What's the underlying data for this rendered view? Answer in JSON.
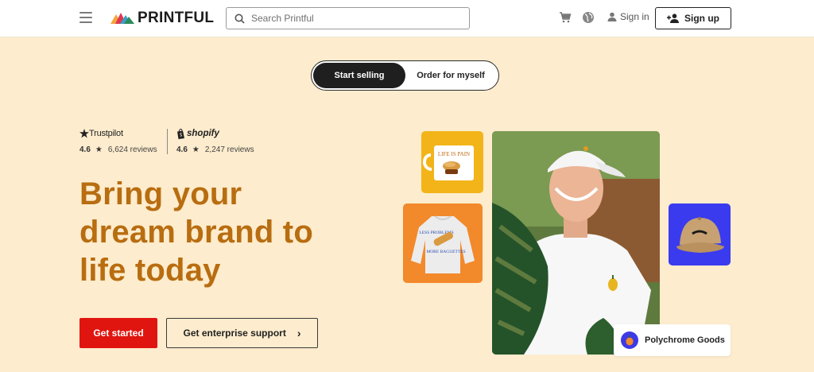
{
  "header": {
    "logo_text": "PRINTFUL",
    "search_placeholder": "Search Printful",
    "signin_label": "Sign in",
    "signup_label": "Sign up",
    "icons": [
      "menu-icon",
      "search-icon",
      "cart-icon",
      "globe-icon",
      "user-icon",
      "add-user-icon"
    ]
  },
  "toggle": {
    "active_label": "Start selling",
    "inactive_label": "Order for myself"
  },
  "ratings": {
    "trustpilot": {
      "brand": "Trustpilot",
      "score": "4.6",
      "reviews": "6,624 reviews"
    },
    "shopify": {
      "brand": "shopify",
      "score": "4.6",
      "reviews": "2,247 reviews"
    }
  },
  "hero": {
    "headline_line1": "Bring your",
    "headline_line2": "dream brand to",
    "headline_line3": "life today",
    "primary_cta": "Get started",
    "secondary_cta": "Get enterprise support"
  },
  "showcase": {
    "mug_text": "LIFE IS PAIN",
    "sweatshirt_text_top": "LESS PROBLEMS",
    "sweatshirt_text_bottom": "MORE BAGUETTES",
    "brand_name": "Polychrome Goods"
  },
  "colors": {
    "page_bg": "#fdeccd",
    "headline": "#b86d10",
    "primary_cta": "#e0150f",
    "mug_tile": "#f2b418",
    "sweat_tile": "#f2892b",
    "cap_tile": "#3a3bef"
  }
}
